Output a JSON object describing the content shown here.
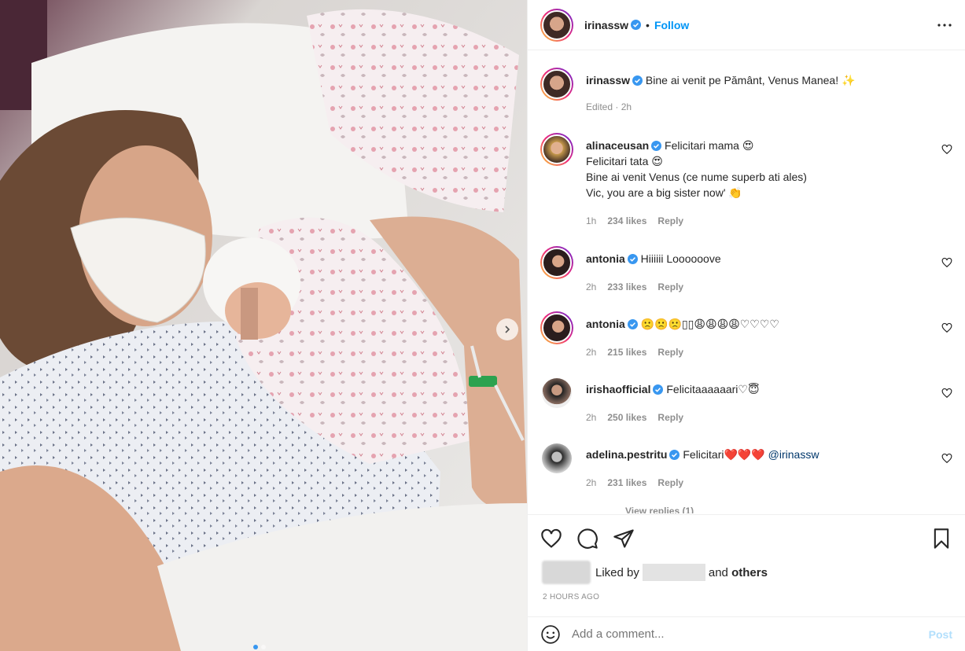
{
  "post": {
    "author": "irinassw",
    "follow_label": "Follow",
    "separator": "•"
  },
  "caption": {
    "username": "irinassw",
    "text": "Bine ai venit pe Pământ, Venus Manea! ✨",
    "meta": "Edited · 2h"
  },
  "comments": [
    {
      "username": "alinaceusan",
      "lines": [
        "Felicitari mama 😍",
        "Felicitari tata 😍",
        "Bine ai venit Venus (ce nume superb ati ales)",
        "Vic, you are a big sister now' 👏"
      ],
      "time": "1h",
      "likes": "234 likes",
      "reply": "Reply"
    },
    {
      "username": "antonia",
      "lines": [
        "Hiiiiii Loooooove"
      ],
      "time": "2h",
      "likes": "233 likes",
      "reply": "Reply"
    },
    {
      "username": "antonia",
      "lines": [
        "🙁🙁🙁▯▯😩😩😩😩♡♡♡♡"
      ],
      "time": "2h",
      "likes": "215 likes",
      "reply": "Reply"
    },
    {
      "username": "irishaofficial",
      "lines": [
        "Felicitaaaaaari♡😇"
      ],
      "time": "2h",
      "likes": "250 likes",
      "reply": "Reply"
    },
    {
      "username": "adelina.pestritu",
      "lines": [
        "Felicitari❤️❤️❤️ "
      ],
      "mention": "@irinassw",
      "time": "2h",
      "likes": "231 likes",
      "reply": "Reply"
    }
  ],
  "view_replies": "View replies (1)",
  "likes": {
    "liked_by": "Liked by",
    "and": "and",
    "others": "others"
  },
  "timestamp": "2 HOURS AGO",
  "comment_box": {
    "placeholder": "Add a comment...",
    "post_label": "Post"
  },
  "carousel": {
    "current": 1,
    "total": 2
  },
  "colors": {
    "accent": "#0095f6",
    "verified": "#3897f0",
    "link": "#00376b"
  }
}
